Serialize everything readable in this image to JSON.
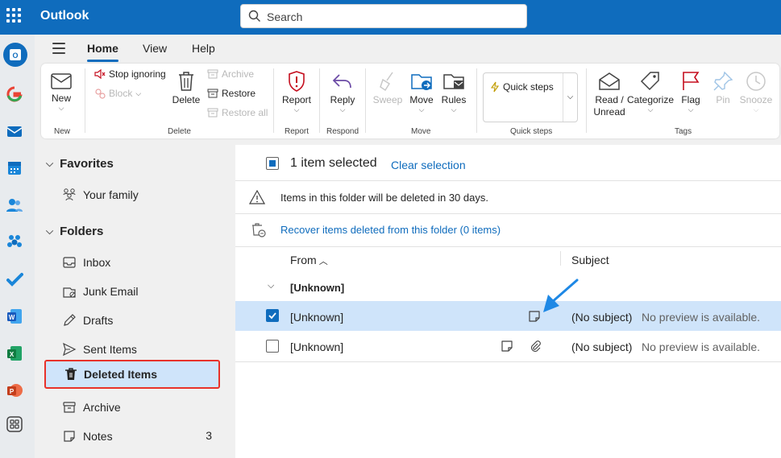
{
  "app": {
    "title": "Outlook"
  },
  "search": {
    "placeholder": "Search"
  },
  "rail": {
    "apps": [
      "outlook-icon",
      "google-icon",
      "mail-icon",
      "calendar-icon",
      "people-icon",
      "teams-icon",
      "todo-icon",
      "word-icon",
      "excel-icon",
      "powerpoint-icon",
      "apps-icon"
    ]
  },
  "tabs": [
    "Home",
    "View",
    "Help"
  ],
  "ribbon": {
    "new": "New",
    "new_group": "New",
    "stop_ignoring": "Stop ignoring",
    "block": "Block",
    "delete": "Delete",
    "archive": "Archive",
    "restore": "Restore",
    "restore_all": "Restore all",
    "delete_group": "Delete",
    "report": "Report",
    "report_group": "Report",
    "reply": "Reply",
    "respond_group": "Respond",
    "sweep": "Sweep",
    "move": "Move",
    "rules": "Rules",
    "move_group": "Move",
    "quick_steps": "Quick steps",
    "quick_steps_group": "Quick steps",
    "read_unread_1": "Read /",
    "read_unread_2": "Unread",
    "categorize": "Categorize",
    "flag": "Flag",
    "pin": "Pin",
    "snooze": "Snooze",
    "tags_group": "Tags"
  },
  "nav": {
    "favorites": "Favorites",
    "your_family": "Your family",
    "folders": "Folders",
    "inbox": "Inbox",
    "junk": "Junk Email",
    "drafts": "Drafts",
    "sent": "Sent Items",
    "deleted": "Deleted Items",
    "archive": "Archive",
    "notes": "Notes",
    "notes_count": "3"
  },
  "list": {
    "selected_text": "1 item selected",
    "clear_selection": "Clear selection",
    "notice": "Items in this folder will be deleted in 30 days.",
    "recover": "Recover items deleted from this folder (0 items)",
    "col_from": "From",
    "col_subject": "Subject",
    "group_label": "[Unknown]",
    "rows": [
      {
        "from": "[Unknown]",
        "subject": "(No subject)",
        "preview": "No preview is available.",
        "checked": true
      },
      {
        "from": "[Unknown]",
        "subject": "(No subject)",
        "preview": "No preview is available.",
        "checked": false
      }
    ]
  },
  "colors": {
    "accent": "#0f6cbd",
    "selected_row": "#cfe4fa",
    "highlight_box": "#e8322a",
    "annotation_arrow": "#1e88e5"
  }
}
